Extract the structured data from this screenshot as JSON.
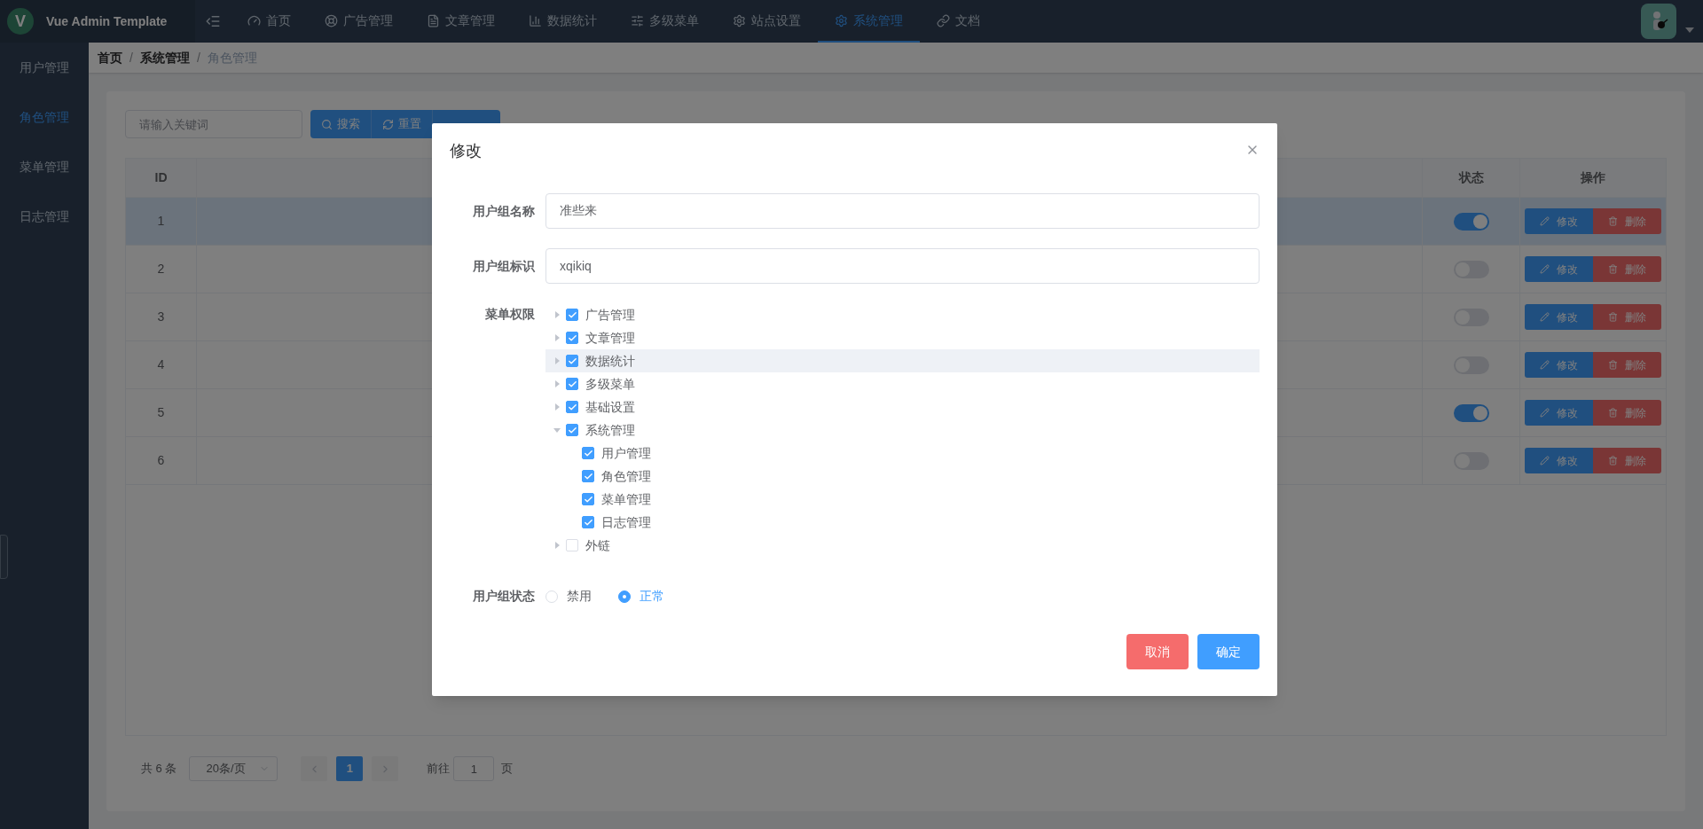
{
  "header": {
    "logo": "V",
    "title": "Vue Admin Template",
    "nav": [
      {
        "label": "首页",
        "selected": false
      },
      {
        "label": "广告管理",
        "selected": false
      },
      {
        "label": "文章管理",
        "selected": false
      },
      {
        "label": "数据统计",
        "selected": false
      },
      {
        "label": "多级菜单",
        "selected": false
      },
      {
        "label": "站点设置",
        "selected": false
      },
      {
        "label": "系统管理",
        "selected": true
      },
      {
        "label": "文档",
        "selected": false
      }
    ]
  },
  "sidebar": {
    "items": [
      {
        "label": "用户管理",
        "selected": false
      },
      {
        "label": "角色管理",
        "selected": true
      },
      {
        "label": "菜单管理",
        "selected": false
      },
      {
        "label": "日志管理",
        "selected": false
      }
    ]
  },
  "breadcrumb": [
    {
      "text": "首页",
      "kind": "link"
    },
    {
      "text": "/",
      "kind": "separator"
    },
    {
      "text": "系统管理",
      "kind": "link"
    },
    {
      "text": "/",
      "kind": "separator"
    },
    {
      "text": "角色管理",
      "kind": "current"
    }
  ],
  "toolbar": {
    "search": {
      "placeholder": "请输入关键词"
    },
    "buttons": [
      "搜索",
      "重置"
    ]
  },
  "table": {
    "columns": [
      "ID",
      "状态",
      "操作"
    ],
    "rows": [
      {
        "id": "1",
        "on": true,
        "selected": true,
        "actions": [
          "修改",
          "删除"
        ]
      },
      {
        "id": "2",
        "on": false,
        "selected": false,
        "actions": [
          "修改",
          "删除"
        ]
      },
      {
        "id": "3",
        "on": false,
        "selected": false,
        "actions": [
          "修改",
          "删除"
        ]
      },
      {
        "id": "4",
        "on": false,
        "selected": false,
        "actions": [
          "修改",
          "删除"
        ]
      },
      {
        "id": "5",
        "on": true,
        "selected": false,
        "actions": [
          "修改",
          "删除"
        ]
      },
      {
        "id": "6",
        "on": false,
        "selected": false,
        "actions": [
          "修改",
          "删除"
        ]
      }
    ]
  },
  "pagination": {
    "total": "共 6 条",
    "page_size": "20条/页",
    "pages": [
      {
        "label": "1",
        "selected": true
      }
    ],
    "goto_label": "前往",
    "goto_value": "1",
    "goto_suffix": "页"
  },
  "dialog": {
    "title": "修改",
    "name_field": {
      "label": "用户组名称",
      "value": "准些来"
    },
    "key_field": {
      "label": "用户组标识",
      "value": "xqikiq"
    },
    "permissions": {
      "label": "菜单权限",
      "tree": [
        {
          "label": "广告管理",
          "checked": true,
          "expanded": false,
          "selected": false
        },
        {
          "label": "文章管理",
          "checked": true,
          "expanded": false,
          "selected": false
        },
        {
          "label": "数据统计",
          "checked": true,
          "expanded": false,
          "selected": true
        },
        {
          "label": "多级菜单",
          "checked": true,
          "expanded": false,
          "selected": false
        },
        {
          "label": "基础设置",
          "checked": true,
          "expanded": false,
          "selected": false
        },
        {
          "label": "系统管理",
          "checked": true,
          "expanded": true,
          "selected": false,
          "children": [
            {
              "label": "用户管理",
              "checked": true,
              "selected": false
            },
            {
              "label": "角色管理",
              "checked": true,
              "selected": false
            },
            {
              "label": "菜单管理",
              "checked": true,
              "selected": false
            },
            {
              "label": "日志管理",
              "checked": true,
              "selected": false
            }
          ]
        },
        {
          "label": "外链",
          "checked": false,
          "expanded": false,
          "selected": false
        }
      ]
    },
    "status": {
      "label": "用户组状态",
      "options": [
        {
          "label": "禁用",
          "selected": false
        },
        {
          "label": "正常",
          "selected": true
        }
      ]
    },
    "buttons": [
      {
        "label": "取消",
        "kind": "cancel"
      },
      {
        "label": "确定",
        "kind": "confirm"
      }
    ]
  }
}
